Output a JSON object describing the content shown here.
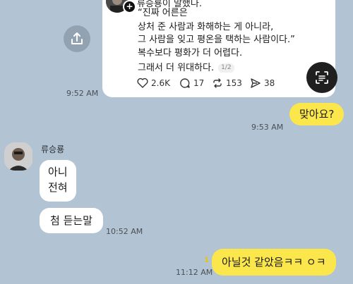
{
  "shared_post": {
    "author_line": "류승룡이 말했다.",
    "lines": [
      "“진짜 어른은",
      "상처 준 사람과 화해하는 게 아니라,",
      "그 사람을 잊고 평온을 택하는 사람이다.”",
      "복수보다 평화가 더 어렵다.",
      "그래서 더 위대하다."
    ],
    "page_indicator": "1/2",
    "stats": {
      "likes": "2.6K",
      "comments": "17",
      "reposts": "153",
      "shares": "38"
    }
  },
  "messages": {
    "shared_post_time": "9:52 AM",
    "msg1_text": "맞아요?",
    "msg1_time": "9:53 AM",
    "sender_name": "류승룡",
    "reply1_line1": "아니",
    "reply1_line2": "전혀",
    "reply2_text": "첨 듣는말",
    "reply_time": "10:52 AM",
    "msg2_text": "아닐것 같았음ㅋㅋ ㅇㅋ",
    "msg2_unread": "1",
    "msg2_time": "11:12 AM"
  },
  "icons": {
    "share": "share-icon",
    "scan": "scan-text-icon",
    "like": "heart-icon",
    "comment": "comment-icon",
    "repost": "repost-icon",
    "send": "send-icon"
  },
  "colors": {
    "chat_background": "#b2c3d3",
    "my_bubble": "#fbe74b",
    "their_bubble": "#ffffff"
  }
}
